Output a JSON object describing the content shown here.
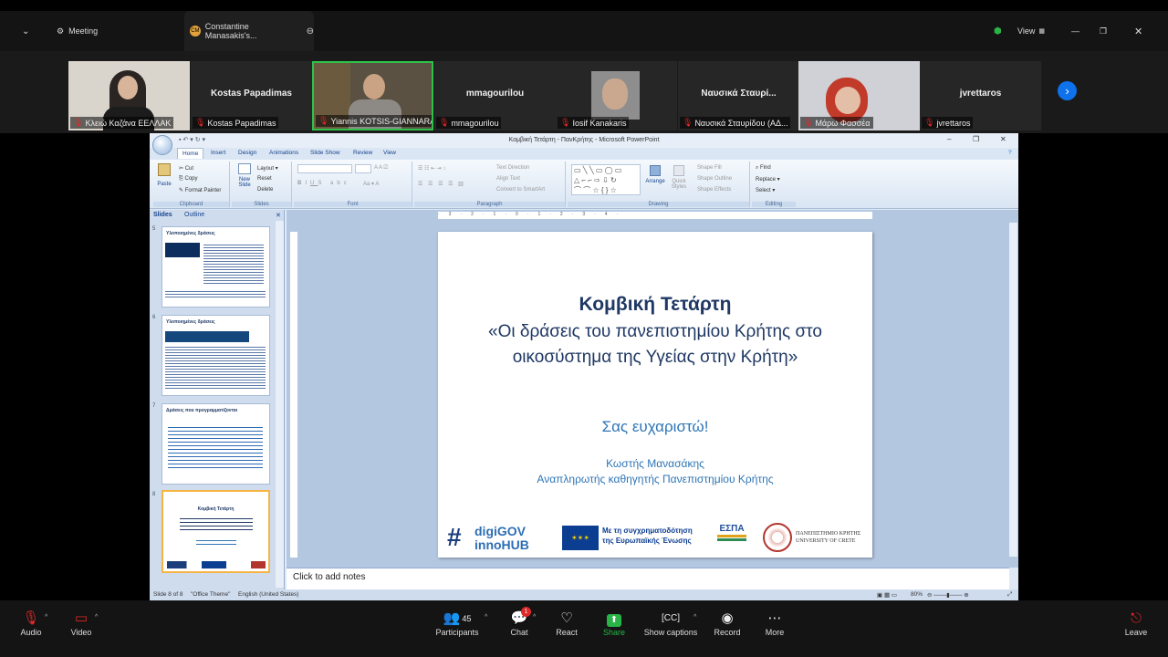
{
  "zoom": {
    "tabs": [
      {
        "label": "Meeting"
      },
      {
        "label": "Constantine Manasakis's...",
        "initials": "CM"
      }
    ],
    "view_label": "View",
    "participants": [
      {
        "name": "",
        "label": "Κλειώ Καζάνα ΕΕΛΛΑΚ"
      },
      {
        "name": "Kostas Papadimas",
        "label": "Kostas Papadimas"
      },
      {
        "name": "",
        "label": "Yiannis KOTSIS-GIANNARA..."
      },
      {
        "name": "mmagourilou",
        "label": "mmagourilou"
      },
      {
        "name": "",
        "label": "Iosif Kanakaris"
      },
      {
        "name": "Ναυσικά Σταυρί...",
        "label": "Ναυσικά Σταυρίδου (ΑΔ..."
      },
      {
        "name": "",
        "label": "Μάρω Φασσέα"
      },
      {
        "name": "jvrettaros",
        "label": "jvrettaros"
      }
    ],
    "toolbar": {
      "audio": "Audio",
      "video": "Video",
      "participants": "Participants",
      "participants_count": "45",
      "chat": "Chat",
      "chat_badge": "1",
      "react": "React",
      "share": "Share",
      "captions": "Show captions",
      "record": "Record",
      "more": "More",
      "leave": "Leave"
    }
  },
  "ppt": {
    "window_title": "Κομβική Τετάρτη - ΠανΚρήτης - Microsoft PowerPoint",
    "tabs": [
      "Home",
      "Insert",
      "Design",
      "Animations",
      "Slide Show",
      "Review",
      "View"
    ],
    "ribbon": {
      "clipboard": {
        "label": "Clipboard",
        "paste": "Paste",
        "cut": "Cut",
        "copy": "Copy",
        "format_painter": "Format Painter"
      },
      "slides": {
        "label": "Slides",
        "new_slide": "New Slide",
        "layout": "Layout",
        "reset": "Reset",
        "delete": "Delete"
      },
      "font": {
        "label": "Font"
      },
      "paragraph": {
        "label": "Paragraph",
        "text_direction": "Text Direction",
        "align_text": "Align Text",
        "smartart": "Convert to SmartArt"
      },
      "drawing": {
        "label": "Drawing",
        "arrange": "Arrange",
        "quick_styles": "Quick Styles",
        "shape_fill": "Shape Fill",
        "shape_outline": "Shape Outline",
        "shape_effects": "Shape Effects"
      },
      "editing": {
        "label": "Editing",
        "find": "Find",
        "replace": "Replace",
        "select": "Select"
      }
    },
    "panel_tabs": [
      "Slides",
      "Outline"
    ],
    "thumbnails": [
      {
        "num": "5",
        "title": "Υλοποιημένες δράσεις",
        "selected": false
      },
      {
        "num": "6",
        "title": "Υλοποιημένες δράσεις",
        "selected": false
      },
      {
        "num": "7",
        "title": "Δράσεις που προγραμματίζονται",
        "selected": false
      },
      {
        "num": "8",
        "title": "Κομβική Τετάρτη",
        "selected": true
      }
    ],
    "slide": {
      "title": "Κομβική Τετάρτη",
      "subtitle": "«Οι δράσεις του πανεπιστημίου Κρήτης στο οικοσύστημα της Υγείας στην Κρήτη»",
      "thanks": "Σας ευχαριστώ!",
      "author": "Κωστής Μανασάκης",
      "position": "Αναπληρωτής καθηγητής Πανεπιστημίου Κρήτης",
      "logo_digigov_line1": "digiGOV",
      "logo_digigov_line2": "innoHUB",
      "eu_text_line1": "Με τη συγχρηματοδότηση",
      "eu_text_line2": "της Ευρωπαϊκής Ένωσης",
      "espa": "ΕΣΠΑ",
      "uoc_line1": "ΠΑΝΕΠΙΣΤΗΜΙΟ ΚΡΗΤΗΣ",
      "uoc_line2": "UNIVERSITY OF CRETE"
    },
    "notes_placeholder": "Click to add notes",
    "status": {
      "slide_info": "Slide 8 of 8",
      "theme": "\"Office Theme\"",
      "language": "English (United States)",
      "zoom": "80%"
    }
  }
}
